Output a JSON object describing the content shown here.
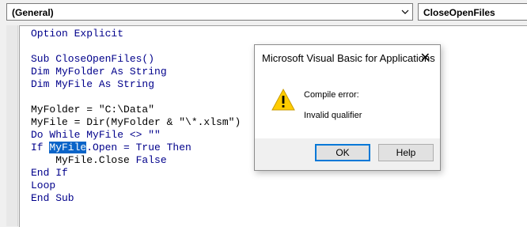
{
  "toolbar": {
    "object_combo": "(General)",
    "procedure_combo": "CloseOpenFiles"
  },
  "code": {
    "l1": "Option Explicit",
    "l3": "Sub CloseOpenFiles()",
    "l4": "Dim MyFolder As String",
    "l5": "Dim MyFile As String",
    "l7": "MyFolder = \"C:\\Data\"",
    "l8": "MyFile = Dir(MyFolder & \"\\*.xlsm\")",
    "l9": "Do While MyFile <> \"\"",
    "l10_kw": "If ",
    "l10_sel": "MyFile",
    "l10_rest": ".Open = True Then",
    "l11_a": "    MyFile.Close ",
    "l11_kw": "False",
    "l12": "End If",
    "l13": "Loop",
    "l14": "End Sub"
  },
  "dialog": {
    "title": "Microsoft Visual Basic for Applications",
    "close": "✕",
    "message_heading": "Compile error:",
    "message_detail": "Invalid qualifier",
    "ok_label": "OK",
    "help_label": "Help"
  },
  "colors": {
    "keyword": "#00008b",
    "selection": "#0a64c8",
    "ok_border": "#0078d7",
    "warning": "#ffcc00"
  },
  "icons": {
    "combo_arrow": "chevron-down-icon",
    "warning": "warning-icon",
    "close": "close-icon"
  }
}
